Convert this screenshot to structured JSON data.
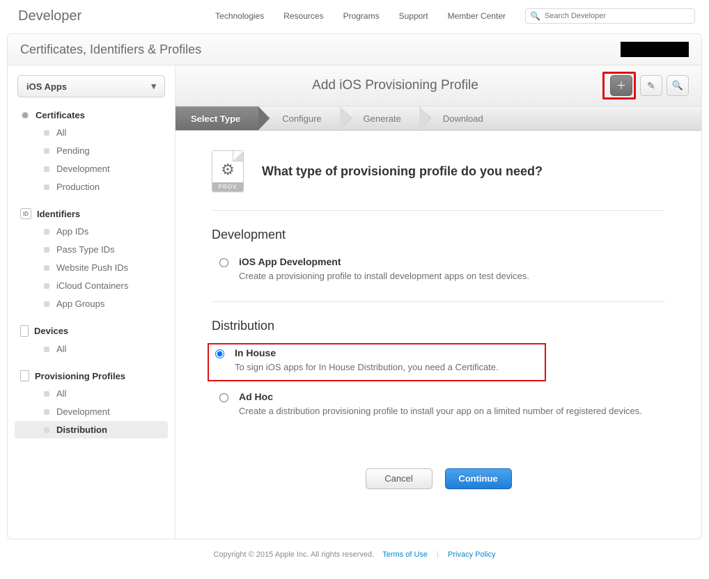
{
  "top": {
    "brand": "Developer",
    "links": [
      "Technologies",
      "Resources",
      "Programs",
      "Support",
      "Member Center"
    ],
    "search_placeholder": "Search Developer"
  },
  "shell": {
    "title": "Certificates, Identifiers & Profiles"
  },
  "sidebar": {
    "selector": "iOS Apps",
    "groups": [
      {
        "title": "Certificates",
        "icon": "rosette",
        "items": [
          "All",
          "Pending",
          "Development",
          "Production"
        ]
      },
      {
        "title": "Identifiers",
        "icon": "id",
        "items": [
          "App IDs",
          "Pass Type IDs",
          "Website Push IDs",
          "iCloud Containers",
          "App Groups"
        ]
      },
      {
        "title": "Devices",
        "icon": "device",
        "items": [
          "All"
        ]
      },
      {
        "title": "Provisioning Profiles",
        "icon": "doc",
        "items": [
          "All",
          "Development",
          "Distribution"
        ],
        "active": "Distribution"
      }
    ]
  },
  "main": {
    "title": "Add iOS Provisioning Profile",
    "steps": [
      "Select Type",
      "Configure",
      "Generate",
      "Download"
    ],
    "active_step": 0,
    "heading": "What type of provisioning profile do you need?",
    "prov_tag": "PROV",
    "sections": [
      {
        "title": "Development",
        "options": [
          {
            "title": "iOS App Development",
            "desc": "Create a provisioning profile to install development apps on test devices.",
            "selected": false,
            "highlight": false
          }
        ]
      },
      {
        "title": "Distribution",
        "options": [
          {
            "title": "In House",
            "desc": "To sign iOS apps for In House Distribution, you need a Certificate.",
            "selected": true,
            "highlight": true
          },
          {
            "title": "Ad Hoc",
            "desc": "Create a distribution provisioning profile to install your app on a limited number of registered devices.",
            "selected": false,
            "highlight": false
          }
        ]
      }
    ],
    "buttons": {
      "cancel": "Cancel",
      "continue": "Continue"
    }
  },
  "footer": {
    "copyright": "Copyright © 2015 Apple Inc. All rights reserved.",
    "links": [
      "Terms of Use",
      "Privacy Policy"
    ]
  }
}
